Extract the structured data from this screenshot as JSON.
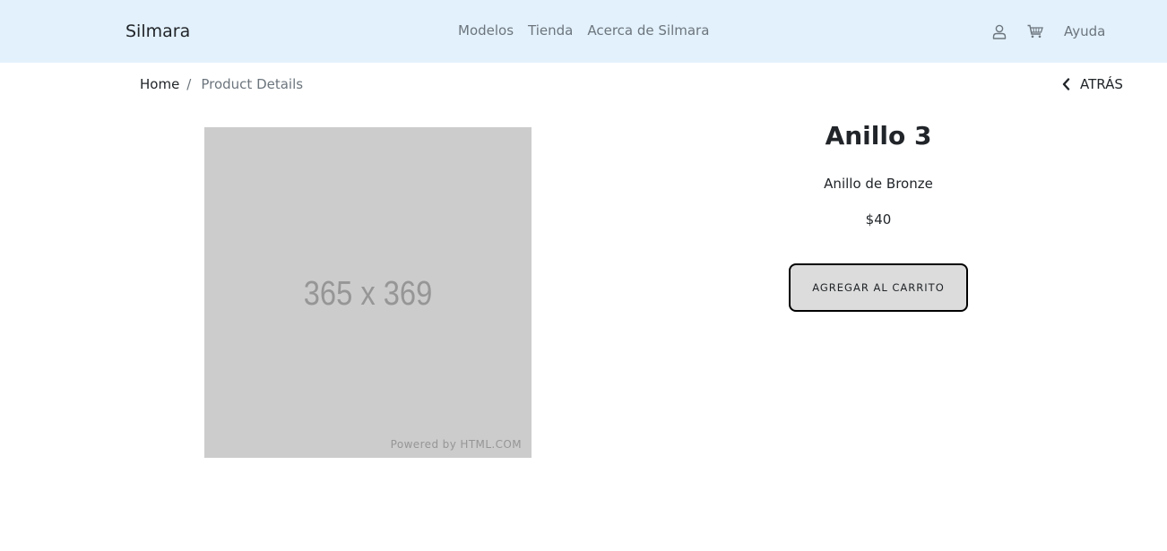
{
  "navbar": {
    "brand": "Silmara",
    "links": [
      "Modelos",
      "Tienda",
      "Acerca de Silmara"
    ],
    "icons": [
      "user-icon",
      "cart-icon"
    ],
    "help": "Ayuda"
  },
  "breadcrumb": {
    "home": "Home",
    "separator": "/",
    "current": "Product Details"
  },
  "back": {
    "label": "ATRÁS",
    "icon": "chevron-left-icon"
  },
  "image": {
    "placeholder_text": "365 x 369",
    "credit": "Powered by HTML.COM"
  },
  "product": {
    "title": "Anillo 3",
    "description": "Anillo de Bronze",
    "price": "$40",
    "add_to_cart": "AGREGAR AL CARRITO"
  },
  "colors": {
    "navbar_bg": "#e3f1fc",
    "image_bg": "#cccccc",
    "button_bg": "#dcdcdc"
  }
}
